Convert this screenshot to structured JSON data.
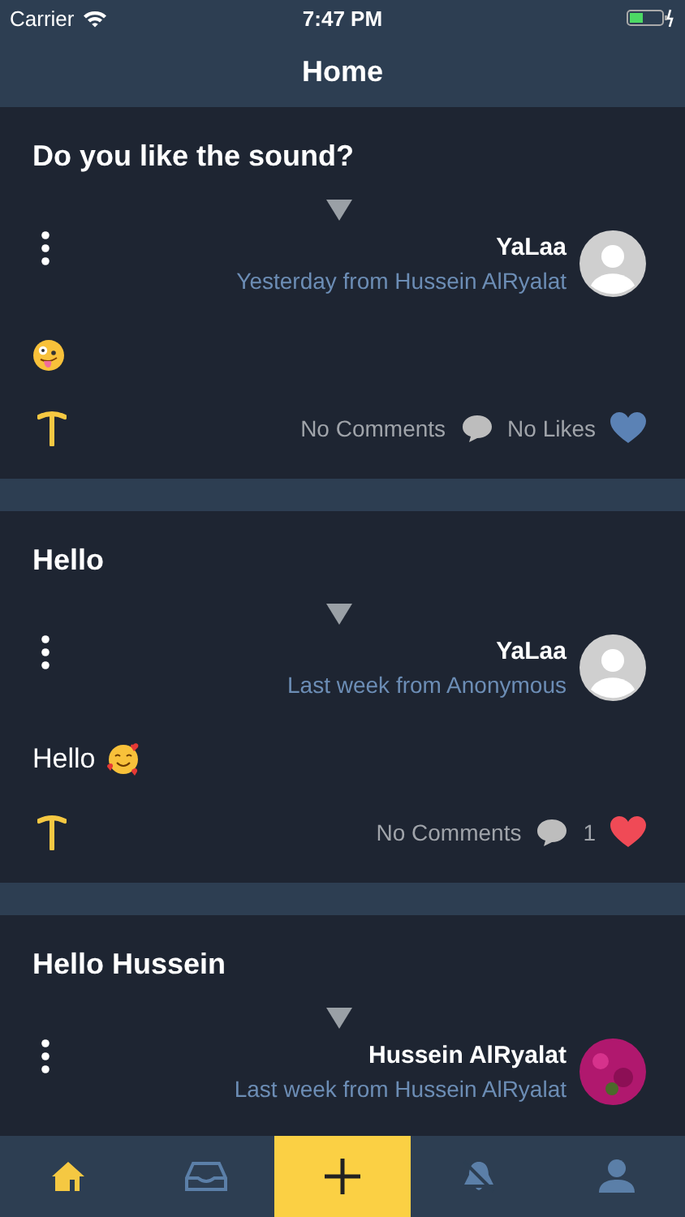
{
  "status_bar": {
    "carrier": "Carrier",
    "time": "7:47 PM"
  },
  "nav": {
    "title": "Home"
  },
  "posts": [
    {
      "title": "Do you like the sound?",
      "author": "YaLaa",
      "meta": "Yesterday from Hussein AlRyalat",
      "avatar": {
        "kind": "placeholder"
      },
      "emoji": {
        "kind": "zany"
      },
      "comments": "No Comments",
      "likes": "No Likes",
      "liked": false
    },
    {
      "title": "Hello",
      "author": "YaLaa",
      "meta": "Last week from Anonymous",
      "avatar": {
        "kind": "placeholder"
      },
      "body": "Hello",
      "emoji": {
        "kind": "hearts"
      },
      "comments": "No Comments",
      "likes": "1",
      "liked": true
    },
    {
      "title": "Hello Hussein",
      "author": "Hussein AlRyalat",
      "meta": "Last week from Hussein AlRyalat",
      "avatar": {
        "kind": "photo"
      }
    }
  ],
  "tabs": [
    {
      "kind": "home",
      "selected": true
    },
    {
      "kind": "inbox",
      "selected": false
    },
    {
      "kind": "add",
      "selected": false
    },
    {
      "kind": "bell",
      "selected": false
    },
    {
      "kind": "profile",
      "selected": false
    }
  ]
}
